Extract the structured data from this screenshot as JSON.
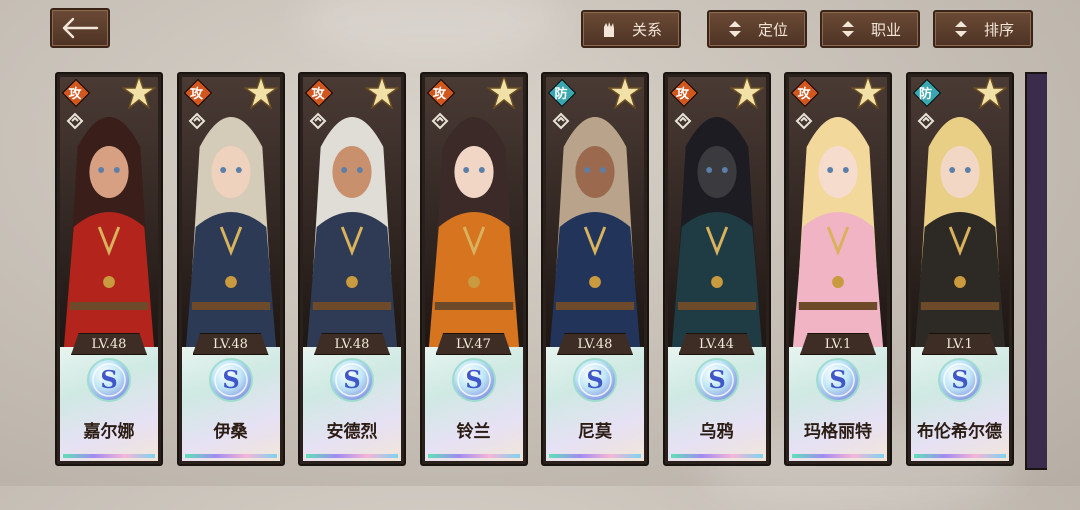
{
  "topbar": {
    "back_icon": "left-arrow-icon",
    "buttons": [
      {
        "label": "关系",
        "icon": "glove-icon"
      },
      {
        "label": "定位",
        "icon": "sort-updown-icon"
      },
      {
        "label": "职业",
        "icon": "sort-updown-icon"
      },
      {
        "label": "排序",
        "icon": "sort-updown-icon"
      }
    ]
  },
  "colors": {
    "attack_badge": "#d2571f",
    "defense_badge": "#3aa7b0",
    "frame": "#2b211c"
  },
  "cards": [
    {
      "name": "嘉尔娜",
      "level": "LV.48",
      "role": "攻",
      "rarity": "S",
      "hair": "#3a1e1a",
      "outfit": "#b3241d",
      "skin": "#d8a083"
    },
    {
      "name": "伊桑",
      "level": "LV.48",
      "role": "攻",
      "rarity": "S",
      "hair": "#d4cbb8",
      "outfit": "#2d3a55",
      "skin": "#efd2bd"
    },
    {
      "name": "安德烈",
      "level": "LV.48",
      "role": "攻",
      "rarity": "S",
      "hair": "#e0ddd6",
      "outfit": "#2f3b54",
      "skin": "#c9906d"
    },
    {
      "name": "铃兰",
      "level": "LV.47",
      "role": "攻",
      "rarity": "S",
      "hair": "#3b2a28",
      "outfit": "#d6741f",
      "skin": "#f1d6c6"
    },
    {
      "name": "尼莫",
      "level": "LV.48",
      "role": "防",
      "rarity": "S",
      "hair": "#b9a48b",
      "outfit": "#22345a",
      "skin": "#9b6a4e"
    },
    {
      "name": "乌鸦",
      "level": "LV.44",
      "role": "攻",
      "rarity": "S",
      "hair": "#1c1c22",
      "outfit": "#1f3c45",
      "skin": "#3a3a3f"
    },
    {
      "name": "玛格丽特",
      "level": "LV.1",
      "role": "攻",
      "rarity": "S",
      "hair": "#f2d89a",
      "outfit": "#f0b4c4",
      "skin": "#f6dccd"
    },
    {
      "name": "布伦希尔德",
      "level": "LV.1",
      "role": "防",
      "rarity": "S",
      "hair": "#e9cf86",
      "outfit": "#2d2a26",
      "skin": "#f3d7c5"
    }
  ]
}
